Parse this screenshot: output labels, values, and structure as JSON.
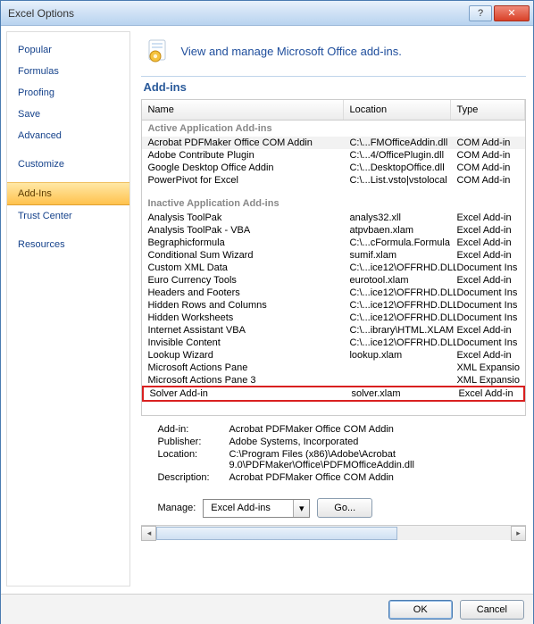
{
  "window": {
    "title": "Excel Options"
  },
  "sidebar": {
    "items": [
      "Popular",
      "Formulas",
      "Proofing",
      "Save",
      "Advanced",
      "Customize",
      "Add-Ins",
      "Trust Center",
      "Resources"
    ],
    "selected": "Add-Ins"
  },
  "banner": {
    "text": "View and manage Microsoft Office add-ins."
  },
  "section": {
    "title": "Add-ins"
  },
  "table": {
    "headers": {
      "name": "Name",
      "location": "Location",
      "type": "Type"
    },
    "groups": [
      {
        "title": "Active Application Add-ins",
        "rows": [
          {
            "name": "Acrobat PDFMaker Office COM Addin",
            "location": "C:\\...FMOfficeAddin.dll",
            "type": "COM Add-in",
            "selected": true
          },
          {
            "name": "Adobe Contribute Plugin",
            "location": "C:\\...4/OfficePlugin.dll",
            "type": "COM Add-in"
          },
          {
            "name": "Google Desktop Office Addin",
            "location": "C:\\...DesktopOffice.dll",
            "type": "COM Add-in"
          },
          {
            "name": "PowerPivot for Excel",
            "location": "C:\\...List.vsto|vstolocal",
            "type": "COM Add-in"
          }
        ]
      },
      {
        "title": "Inactive Application Add-ins",
        "rows": [
          {
            "name": "Analysis ToolPak",
            "location": "analys32.xll",
            "type": "Excel Add-in"
          },
          {
            "name": "Analysis ToolPak - VBA",
            "location": "atpvbaen.xlam",
            "type": "Excel Add-in"
          },
          {
            "name": "Begraphicformula",
            "location": "C:\\...cFormula.Formula",
            "type": "Excel Add-in"
          },
          {
            "name": "Conditional Sum Wizard",
            "location": "sumif.xlam",
            "type": "Excel Add-in"
          },
          {
            "name": "Custom XML Data",
            "location": "C:\\...ice12\\OFFRHD.DLL",
            "type": "Document Ins"
          },
          {
            "name": "Euro Currency Tools",
            "location": "eurotool.xlam",
            "type": "Excel Add-in"
          },
          {
            "name": "Headers and Footers",
            "location": "C:\\...ice12\\OFFRHD.DLL",
            "type": "Document Ins"
          },
          {
            "name": "Hidden Rows and Columns",
            "location": "C:\\...ice12\\OFFRHD.DLL",
            "type": "Document Ins"
          },
          {
            "name": "Hidden Worksheets",
            "location": "C:\\...ice12\\OFFRHD.DLL",
            "type": "Document Ins"
          },
          {
            "name": "Internet Assistant VBA",
            "location": "C:\\...ibrary\\HTML.XLAM",
            "type": "Excel Add-in"
          },
          {
            "name": "Invisible Content",
            "location": "C:\\...ice12\\OFFRHD.DLL",
            "type": "Document Ins"
          },
          {
            "name": "Lookup Wizard",
            "location": "lookup.xlam",
            "type": "Excel Add-in"
          },
          {
            "name": "Microsoft Actions Pane",
            "location": "",
            "type": "XML Expansio"
          },
          {
            "name": "Microsoft Actions Pane 3",
            "location": "",
            "type": "XML Expansio"
          },
          {
            "name": "Solver Add-in",
            "location": "solver.xlam",
            "type": "Excel Add-in",
            "highlight": true
          }
        ]
      }
    ]
  },
  "details": {
    "rows": [
      {
        "label": "Add-in:",
        "value": "Acrobat PDFMaker Office COM Addin"
      },
      {
        "label": "Publisher:",
        "value": "Adobe Systems, Incorporated"
      },
      {
        "label": "Location:",
        "value": "C:\\Program Files (x86)\\Adobe\\Acrobat 9.0\\PDFMaker\\Office\\PDFMOfficeAddin.dll"
      },
      {
        "label": "Description:",
        "value": "Acrobat PDFMaker Office COM Addin"
      }
    ]
  },
  "manage": {
    "label": "Manage:",
    "selected": "Excel Add-ins",
    "goLabel": "Go..."
  },
  "footer": {
    "ok": "OK",
    "cancel": "Cancel"
  }
}
